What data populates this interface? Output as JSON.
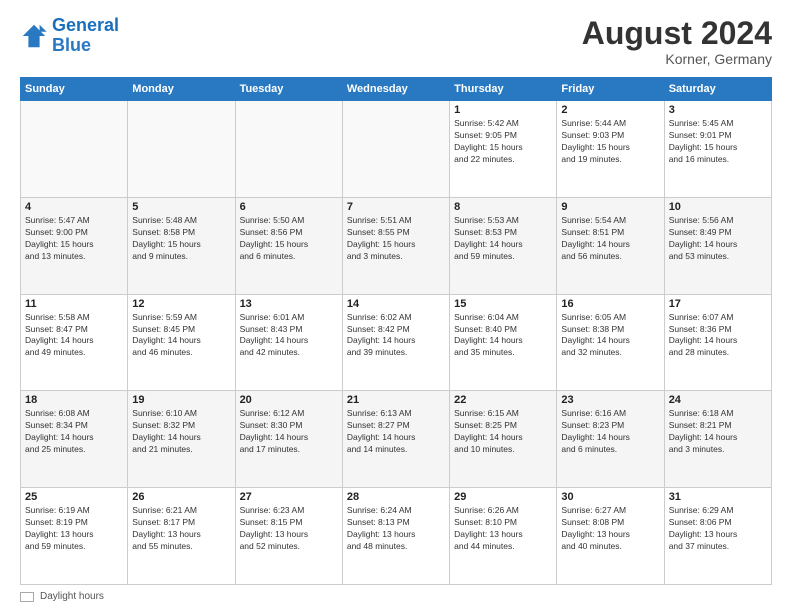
{
  "header": {
    "logo_line1": "General",
    "logo_line2": "Blue",
    "month_year": "August 2024",
    "location": "Korner, Germany"
  },
  "days_of_week": [
    "Sunday",
    "Monday",
    "Tuesday",
    "Wednesday",
    "Thursday",
    "Friday",
    "Saturday"
  ],
  "footer": {
    "label": "Daylight hours"
  },
  "weeks": [
    [
      {
        "day": "",
        "info": ""
      },
      {
        "day": "",
        "info": ""
      },
      {
        "day": "",
        "info": ""
      },
      {
        "day": "",
        "info": ""
      },
      {
        "day": "1",
        "info": "Sunrise: 5:42 AM\nSunset: 9:05 PM\nDaylight: 15 hours\nand 22 minutes."
      },
      {
        "day": "2",
        "info": "Sunrise: 5:44 AM\nSunset: 9:03 PM\nDaylight: 15 hours\nand 19 minutes."
      },
      {
        "day": "3",
        "info": "Sunrise: 5:45 AM\nSunset: 9:01 PM\nDaylight: 15 hours\nand 16 minutes."
      }
    ],
    [
      {
        "day": "4",
        "info": "Sunrise: 5:47 AM\nSunset: 9:00 PM\nDaylight: 15 hours\nand 13 minutes."
      },
      {
        "day": "5",
        "info": "Sunrise: 5:48 AM\nSunset: 8:58 PM\nDaylight: 15 hours\nand 9 minutes."
      },
      {
        "day": "6",
        "info": "Sunrise: 5:50 AM\nSunset: 8:56 PM\nDaylight: 15 hours\nand 6 minutes."
      },
      {
        "day": "7",
        "info": "Sunrise: 5:51 AM\nSunset: 8:55 PM\nDaylight: 15 hours\nand 3 minutes."
      },
      {
        "day": "8",
        "info": "Sunrise: 5:53 AM\nSunset: 8:53 PM\nDaylight: 14 hours\nand 59 minutes."
      },
      {
        "day": "9",
        "info": "Sunrise: 5:54 AM\nSunset: 8:51 PM\nDaylight: 14 hours\nand 56 minutes."
      },
      {
        "day": "10",
        "info": "Sunrise: 5:56 AM\nSunset: 8:49 PM\nDaylight: 14 hours\nand 53 minutes."
      }
    ],
    [
      {
        "day": "11",
        "info": "Sunrise: 5:58 AM\nSunset: 8:47 PM\nDaylight: 14 hours\nand 49 minutes."
      },
      {
        "day": "12",
        "info": "Sunrise: 5:59 AM\nSunset: 8:45 PM\nDaylight: 14 hours\nand 46 minutes."
      },
      {
        "day": "13",
        "info": "Sunrise: 6:01 AM\nSunset: 8:43 PM\nDaylight: 14 hours\nand 42 minutes."
      },
      {
        "day": "14",
        "info": "Sunrise: 6:02 AM\nSunset: 8:42 PM\nDaylight: 14 hours\nand 39 minutes."
      },
      {
        "day": "15",
        "info": "Sunrise: 6:04 AM\nSunset: 8:40 PM\nDaylight: 14 hours\nand 35 minutes."
      },
      {
        "day": "16",
        "info": "Sunrise: 6:05 AM\nSunset: 8:38 PM\nDaylight: 14 hours\nand 32 minutes."
      },
      {
        "day": "17",
        "info": "Sunrise: 6:07 AM\nSunset: 8:36 PM\nDaylight: 14 hours\nand 28 minutes."
      }
    ],
    [
      {
        "day": "18",
        "info": "Sunrise: 6:08 AM\nSunset: 8:34 PM\nDaylight: 14 hours\nand 25 minutes."
      },
      {
        "day": "19",
        "info": "Sunrise: 6:10 AM\nSunset: 8:32 PM\nDaylight: 14 hours\nand 21 minutes."
      },
      {
        "day": "20",
        "info": "Sunrise: 6:12 AM\nSunset: 8:30 PM\nDaylight: 14 hours\nand 17 minutes."
      },
      {
        "day": "21",
        "info": "Sunrise: 6:13 AM\nSunset: 8:27 PM\nDaylight: 14 hours\nand 14 minutes."
      },
      {
        "day": "22",
        "info": "Sunrise: 6:15 AM\nSunset: 8:25 PM\nDaylight: 14 hours\nand 10 minutes."
      },
      {
        "day": "23",
        "info": "Sunrise: 6:16 AM\nSunset: 8:23 PM\nDaylight: 14 hours\nand 6 minutes."
      },
      {
        "day": "24",
        "info": "Sunrise: 6:18 AM\nSunset: 8:21 PM\nDaylight: 14 hours\nand 3 minutes."
      }
    ],
    [
      {
        "day": "25",
        "info": "Sunrise: 6:19 AM\nSunset: 8:19 PM\nDaylight: 13 hours\nand 59 minutes."
      },
      {
        "day": "26",
        "info": "Sunrise: 6:21 AM\nSunset: 8:17 PM\nDaylight: 13 hours\nand 55 minutes."
      },
      {
        "day": "27",
        "info": "Sunrise: 6:23 AM\nSunset: 8:15 PM\nDaylight: 13 hours\nand 52 minutes."
      },
      {
        "day": "28",
        "info": "Sunrise: 6:24 AM\nSunset: 8:13 PM\nDaylight: 13 hours\nand 48 minutes."
      },
      {
        "day": "29",
        "info": "Sunrise: 6:26 AM\nSunset: 8:10 PM\nDaylight: 13 hours\nand 44 minutes."
      },
      {
        "day": "30",
        "info": "Sunrise: 6:27 AM\nSunset: 8:08 PM\nDaylight: 13 hours\nand 40 minutes."
      },
      {
        "day": "31",
        "info": "Sunrise: 6:29 AM\nSunset: 8:06 PM\nDaylight: 13 hours\nand 37 minutes."
      }
    ]
  ]
}
